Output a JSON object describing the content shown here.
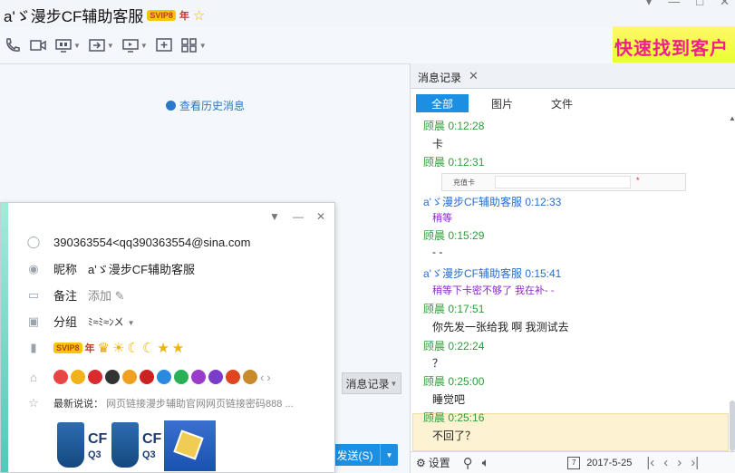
{
  "window": {
    "title": "a'ゞ漫步CF辅助客服",
    "svip_badge": "SVIP8",
    "year_badge": "年",
    "controls": [
      "▾",
      "—",
      "□",
      "✕"
    ]
  },
  "toolbar": {
    "items": [
      "phone-icon",
      "video-icon",
      "screen-share-icon",
      "file-transfer-icon",
      "remote-desktop-icon",
      "app-add-icon",
      "apps-grid-icon"
    ]
  },
  "banner": {
    "text": "快速找到客户"
  },
  "chat": {
    "history_link": "查看历史消息",
    "msglog_button": "消息记录",
    "send_button": "发送(S)"
  },
  "profile_popup": {
    "account": "390363554<qq390363554@sina.com",
    "nickname_label": "昵称",
    "nickname": "a'ゞ漫步CF辅助客服",
    "note_label": "备注",
    "note_action": "添加",
    "group_label": "分组",
    "group_value": "ﾐ≈ﾐ≈ﾝㄨ",
    "signature_label": "最新说说：",
    "signature": "网页链接漫步辅助官网网页链接密码888 ...",
    "logo_text_1": "CF",
    "logo_sub_1": "Q3",
    "logo_text_2": "CF",
    "logo_sub_2": "Q3",
    "vip_badge": "SVIP8",
    "vip_year": "年"
  },
  "message_log": {
    "tab_title": "消息记录",
    "filters": [
      "全部",
      "图片",
      "文件"
    ],
    "active_filter": "全部",
    "card_label": "充值卡",
    "messages": [
      {
        "sender": "顾晨",
        "time": "0:12:28",
        "text": "卡",
        "side": "me"
      },
      {
        "sender": "顾晨",
        "time": "0:12:31",
        "text": "",
        "side": "me"
      },
      {
        "sender": "a'ゞ漫步CF辅助客服",
        "time": "0:12:33",
        "text": "稍等",
        "side": "other"
      },
      {
        "sender": "顾晨",
        "time": "0:15:29",
        "text": "- -",
        "side": "me"
      },
      {
        "sender": "a'ゞ漫步CF辅助客服",
        "time": "0:15:41",
        "text": "稍等下卡密不够了  我在补- -",
        "side": "other"
      },
      {
        "sender": "顾晨",
        "time": "0:17:51",
        "text": "你先发一张给我 啊 我测试去",
        "side": "me"
      },
      {
        "sender": "顾晨",
        "time": "0:22:24",
        "text": "？",
        "side": "me"
      },
      {
        "sender": "顾晨",
        "time": "0:25:00",
        "text": "睡觉吧",
        "side": "me"
      },
      {
        "sender": "顾晨",
        "time": "0:25:16",
        "text": "不回了？",
        "side": "me"
      }
    ],
    "footer": {
      "settings": "设置",
      "date": "2017-5-25"
    }
  },
  "colors": {
    "accent": "#1c8fe2",
    "me_name": "#2f9c3a",
    "other_name": "#2a6fd0",
    "purple_text": "#8b2bc6",
    "highlight": "#fdf3d3"
  }
}
